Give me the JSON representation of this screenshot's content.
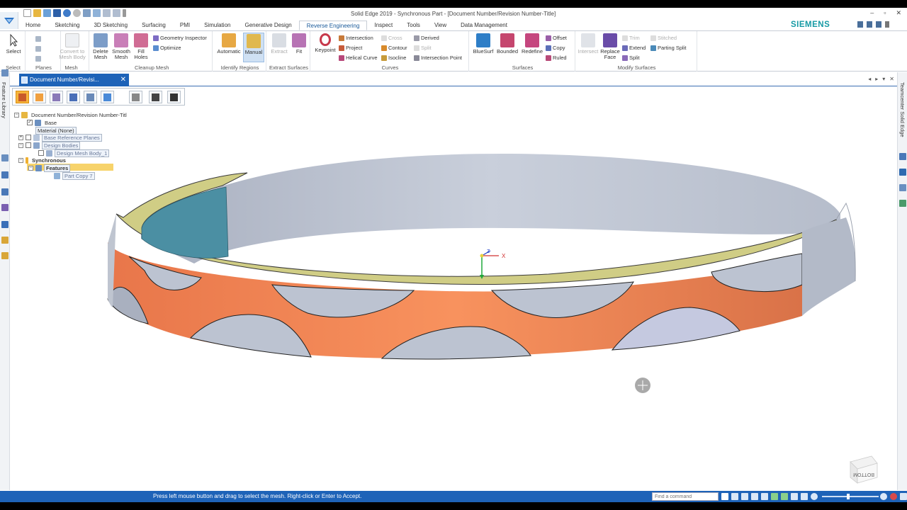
{
  "window": {
    "title": "Solid Edge 2019 - Synchronous Part - [Document Number/Revision Number-Title]",
    "controls": [
      "–",
      "▫",
      "✕"
    ]
  },
  "brand": "SIEMENS",
  "tabs": [
    {
      "label": "Home"
    },
    {
      "label": "Sketching"
    },
    {
      "label": "3D Sketching"
    },
    {
      "label": "Surfacing"
    },
    {
      "label": "PMI"
    },
    {
      "label": "Simulation"
    },
    {
      "label": "Generative Design"
    },
    {
      "label": "Reverse Engineering",
      "active": true
    },
    {
      "label": "Inspect"
    },
    {
      "label": "Tools"
    },
    {
      "label": "View"
    },
    {
      "label": "Data Management"
    }
  ],
  "ribbon": {
    "groups": {
      "select": "Select",
      "planes": "Planes",
      "mesh": "Mesh",
      "cleanup": "Cleanup Mesh",
      "identify": "Identify Regions",
      "extract": "Extract Surfaces",
      "curves": "Curves",
      "surfaces": "Surfaces",
      "modify": "Modify Surfaces"
    },
    "buttons": {
      "select": "Select",
      "convert1": "Convert to",
      "convert2": "Mesh Body",
      "delete1": "Delete",
      "delete2": "Mesh",
      "smooth1": "Smooth",
      "smooth2": "Mesh",
      "fill1": "Fill",
      "fill2": "Holes",
      "geometry_inspector": "Geometry Inspector",
      "optimize": "Optimize",
      "automatic": "Automatic",
      "manual": "Manual",
      "extract": "Extract",
      "fit": "Fit",
      "keypoint": "Keypoint",
      "intersection": "Intersection",
      "project": "Project",
      "helical_curve": "Helical Curve",
      "cross": "Cross",
      "contour": "Contour",
      "isocline": "Isocline",
      "derived": "Derived",
      "split_curve": "Split",
      "intersection_point": "Intersection Point",
      "bluesurf": "BlueSurf",
      "bounded": "Bounded",
      "redefine": "Redefine",
      "offset": "Offset",
      "copy": "Copy",
      "ruled": "Ruled",
      "intersect": "Intersect",
      "replace1": "Replace",
      "replace2": "Face",
      "trim": "Trim",
      "extend": "Extend",
      "split": "Split",
      "stitched": "Stitched",
      "parting_split": "Parting Split"
    }
  },
  "doc_tab": {
    "label": "Document Number/Revisi...",
    "close": "✕"
  },
  "side_panels": {
    "left": "Feature Library",
    "right": "Teamcenter Solid Edge"
  },
  "tree": {
    "root": "Document Number/Revision Number-Titl",
    "items": [
      {
        "label": "Base"
      },
      {
        "label": "Material (None)"
      },
      {
        "label": "Base Reference Planes"
      },
      {
        "label": "Design Bodies"
      },
      {
        "label": "Design Mesh Body_1"
      },
      {
        "label": "Synchronous"
      },
      {
        "label": "Features"
      },
      {
        "label": "Part Copy 7"
      }
    ]
  },
  "viewcube_label": "BOTTOM",
  "triad": {
    "x": "X",
    "z": "Z"
  },
  "status": {
    "message": "Press left mouse button and drag to select the mesh. Right-click or Enter to Accept.",
    "command_placeholder": "Find a command"
  },
  "colors": {
    "accent_blue": "#1e63b8",
    "brand_teal": "#169aa4",
    "mesh_orange": "#f58a58",
    "mesh_grey": "#bcc3d1",
    "top_face": "#d0cd85",
    "selected_teal": "#4b8fa3"
  }
}
